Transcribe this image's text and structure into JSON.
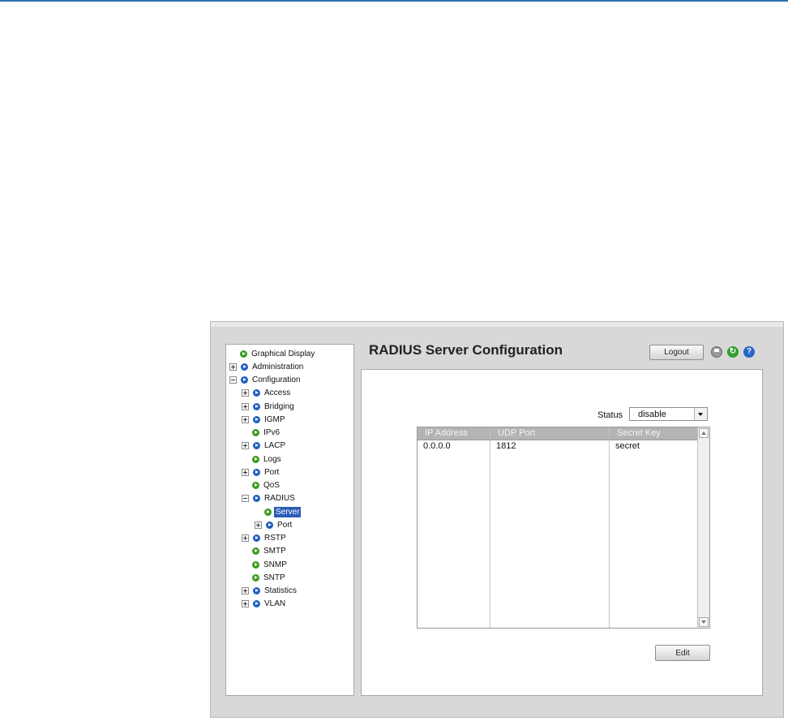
{
  "header": {
    "title": "RADIUS Server Configuration",
    "logout_label": "Logout",
    "icons": [
      "save-icon",
      "refresh-icon",
      "help-icon"
    ],
    "refresh_glyph": "↻",
    "help_glyph": "?"
  },
  "nav": {
    "items": [
      {
        "label": "Graphical Display",
        "toggle": "none",
        "icon": "green"
      },
      {
        "label": "Administration",
        "toggle": "plus",
        "icon": "blue"
      },
      {
        "label": "Configuration",
        "toggle": "minus",
        "icon": "blue"
      },
      {
        "label": "Access",
        "toggle": "plus",
        "icon": "blue"
      },
      {
        "label": "Bridging",
        "toggle": "plus",
        "icon": "blue"
      },
      {
        "label": "IGMP",
        "toggle": "plus",
        "icon": "blue"
      },
      {
        "label": "IPv6",
        "toggle": "none",
        "icon": "green"
      },
      {
        "label": "LACP",
        "toggle": "plus",
        "icon": "blue"
      },
      {
        "label": "Logs",
        "toggle": "none",
        "icon": "green"
      },
      {
        "label": "Port",
        "toggle": "plus",
        "icon": "blue"
      },
      {
        "label": "QoS",
        "toggle": "none",
        "icon": "green"
      },
      {
        "label": "RADIUS",
        "toggle": "minus",
        "icon": "blue"
      },
      {
        "label": "Server",
        "toggle": "none",
        "icon": "green",
        "selected": true
      },
      {
        "label": "Port",
        "toggle": "plus",
        "icon": "blue"
      },
      {
        "label": "RSTP",
        "toggle": "plus",
        "icon": "blue"
      },
      {
        "label": "SMTP",
        "toggle": "none",
        "icon": "green"
      },
      {
        "label": "SNMP",
        "toggle": "none",
        "icon": "green"
      },
      {
        "label": "SNTP",
        "toggle": "none",
        "icon": "green"
      },
      {
        "label": "Statistics",
        "toggle": "plus",
        "icon": "blue"
      },
      {
        "label": "VLAN",
        "toggle": "plus",
        "icon": "blue"
      }
    ]
  },
  "status": {
    "label": "Status",
    "value": "disable"
  },
  "table": {
    "columns": [
      "IP Address",
      "UDP Port",
      "Secret Key"
    ],
    "rows": [
      [
        "0.0.0.0",
        "1812",
        "secret"
      ]
    ]
  },
  "actions": {
    "edit_label": "Edit"
  },
  "colors": {
    "accent": "#2f6fb0",
    "selection": "#2a5db8",
    "node_blue": "#1f5fbf",
    "node_green": "#3b9a1e"
  }
}
